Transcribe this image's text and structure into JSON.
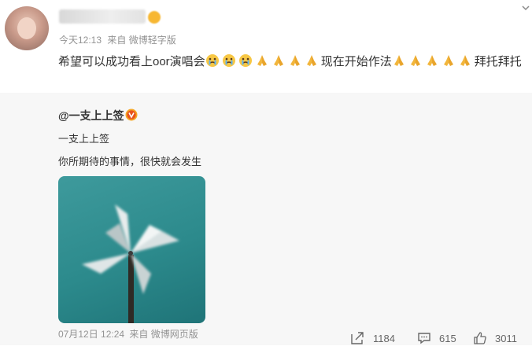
{
  "post": {
    "meta": {
      "time": "今天12:13",
      "source": "来自 微博轻字版"
    },
    "text_part1": "希望可以成功看上oor演唱会",
    "text_part2": "现在开始作法",
    "text_part3": "拜托拜托"
  },
  "repost": {
    "author": "@一支上上签",
    "line1": "一支上上签",
    "line2": "你所期待的事情，很快就会发生",
    "meta": {
      "date": "07月12日 12:24",
      "source": "来自 微博网页版"
    }
  },
  "actions": {
    "repost_count": "1184",
    "comment_count": "615",
    "like_count": "3011"
  },
  "colors": {
    "meta_gray": "#939393",
    "repost_bg": "#f7f7f7",
    "badge": "#f6a623"
  }
}
